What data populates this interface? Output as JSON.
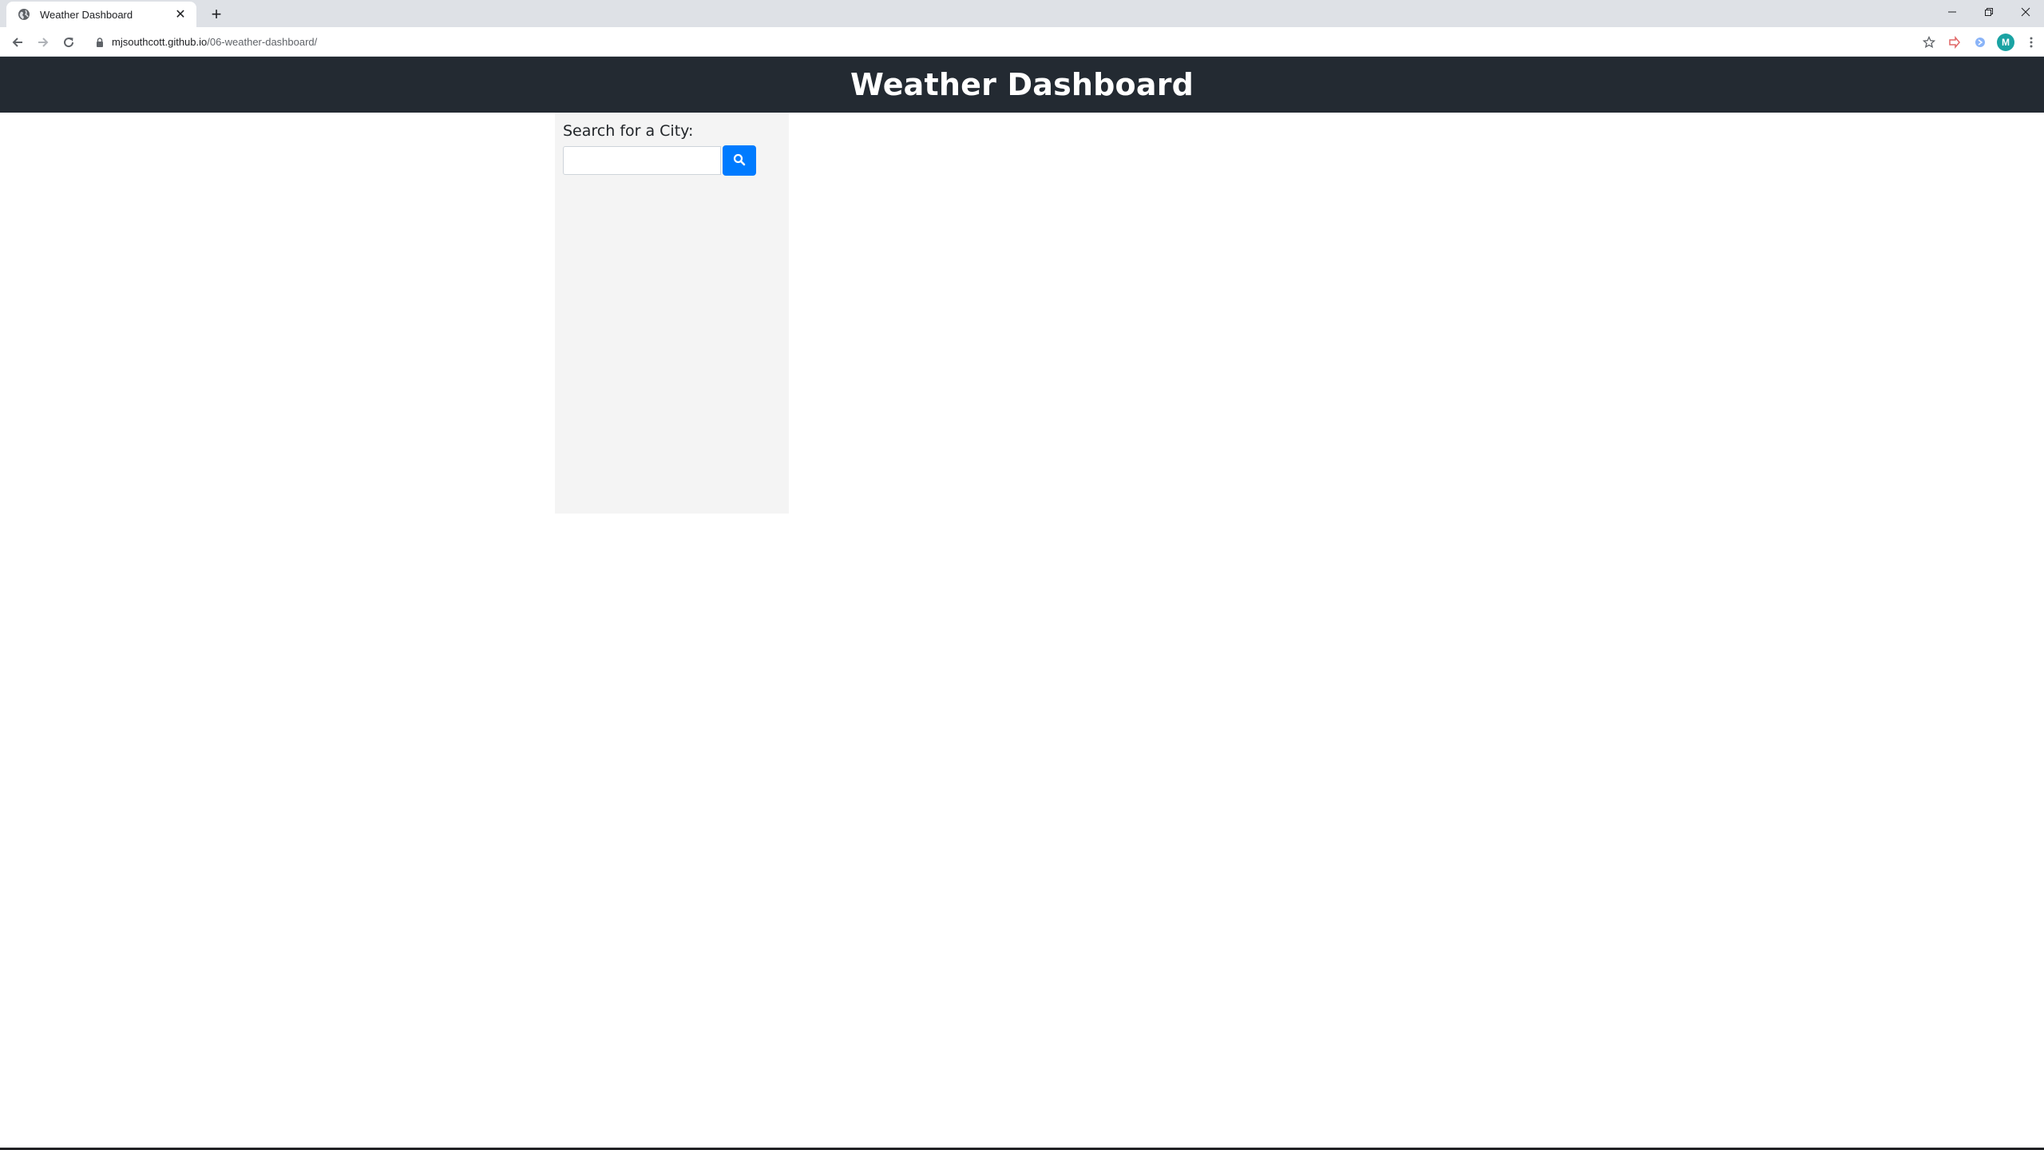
{
  "browser": {
    "tab": {
      "title": "Weather Dashboard",
      "favicon": "globe-icon",
      "close_icon": "close-icon"
    },
    "new_tab_icon": "plus-icon",
    "address": {
      "host": "mjsouthcott.github.io",
      "path": "/06-weather-dashboard/"
    },
    "profile_initial": "M",
    "window_controls": [
      "minimize-icon",
      "restore-icon",
      "close-icon"
    ]
  },
  "header": {
    "title": "Weather Dashboard",
    "background": "#232a32"
  },
  "search": {
    "label": "Search for a City:",
    "input_value": "",
    "placeholder": "",
    "button_icon": "search-icon",
    "button_color": "#007bff"
  }
}
